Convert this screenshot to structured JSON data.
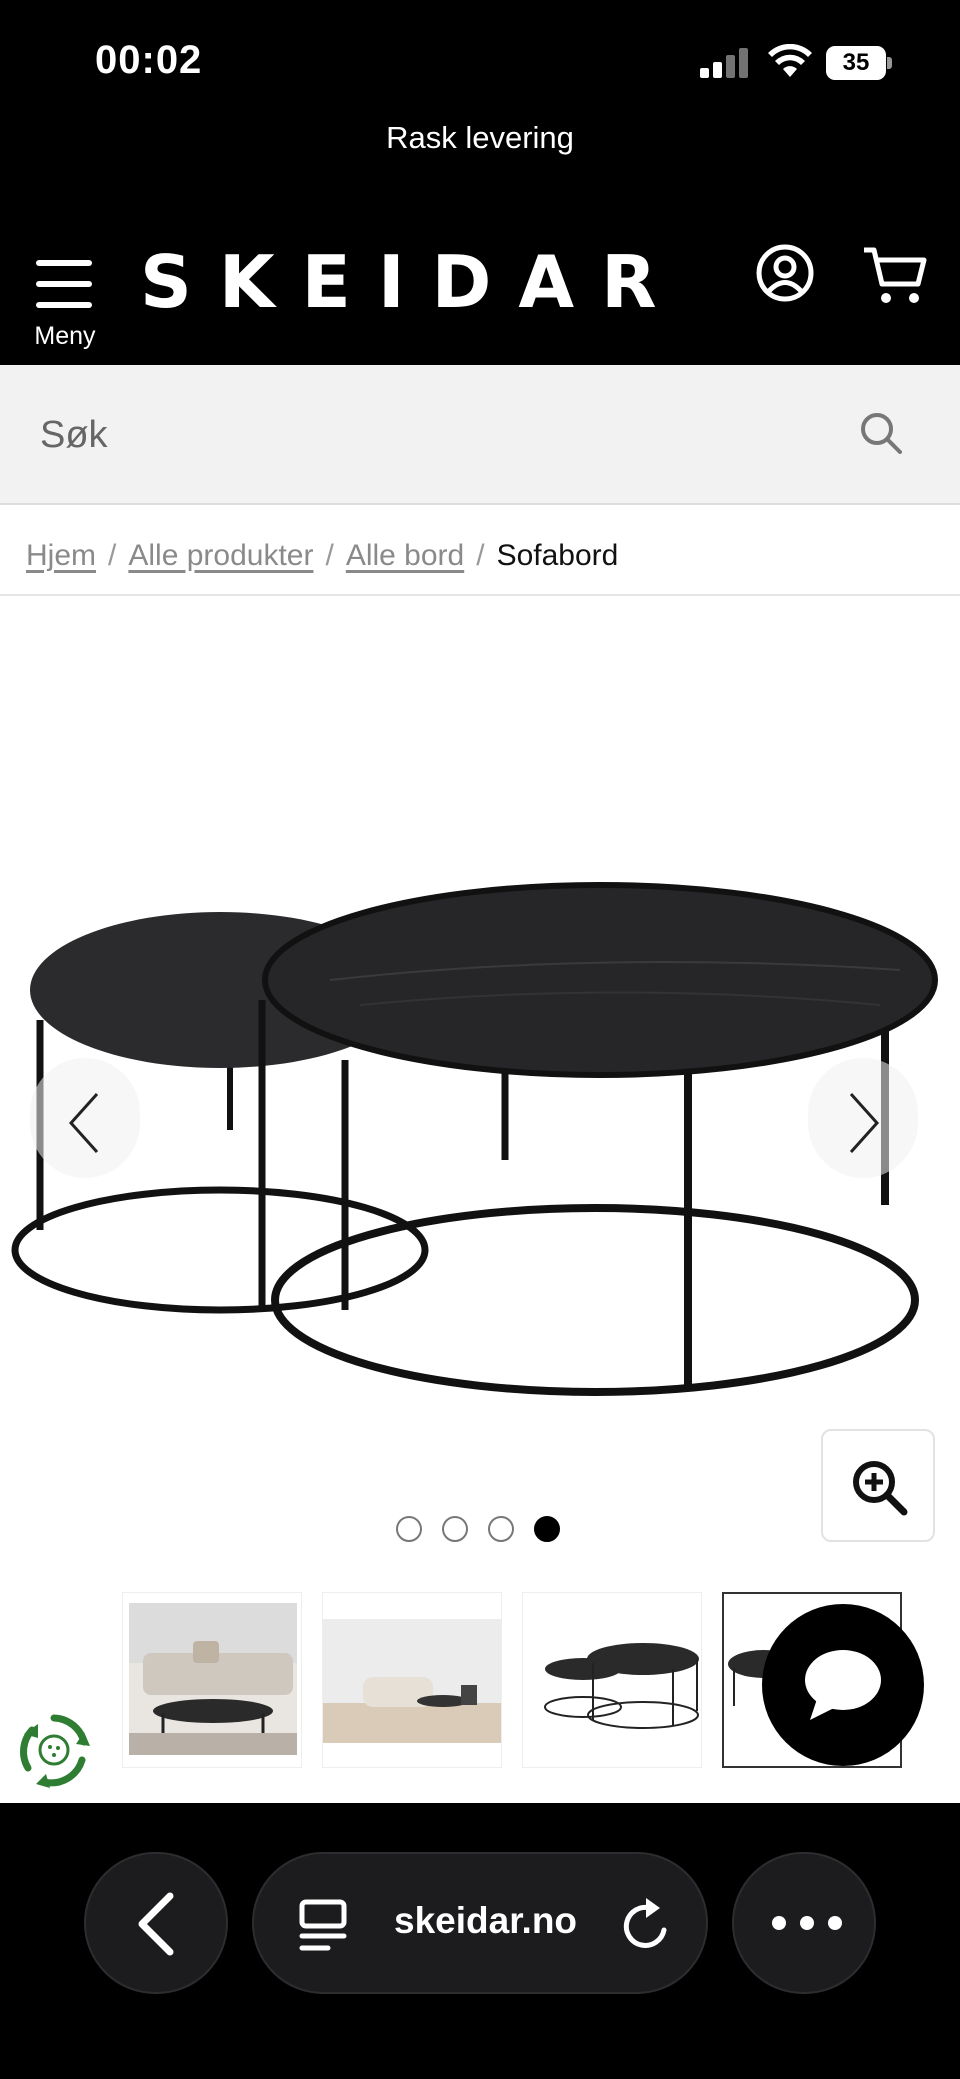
{
  "status_bar": {
    "time": "00:02",
    "battery": "35"
  },
  "promo": {
    "text": "Rask levering"
  },
  "header": {
    "logo": "SKEIDAR",
    "menu_label": "Meny"
  },
  "search": {
    "placeholder": "Søk",
    "value": ""
  },
  "breadcrumb": [
    {
      "label": "Hjem",
      "link": true
    },
    {
      "label": "Alle produkter",
      "link": true
    },
    {
      "label": "Alle bord",
      "link": true
    },
    {
      "label": "Sofabord",
      "link": false
    }
  ],
  "gallery": {
    "total_images": 4,
    "active_index": 4
  },
  "browser": {
    "url": "skeidar.no"
  },
  "icons": {
    "menu": "hamburger-icon",
    "account": "user-circle-icon",
    "cart": "cart-icon",
    "search": "search-icon",
    "prev": "chevron-left-icon",
    "next": "chevron-right-icon",
    "zoom": "zoom-in-icon",
    "chat": "chat-bubble-icon",
    "eco": "recycle-leaf-icon",
    "back": "back-chevron-icon",
    "tabs": "tabs-icon",
    "reload": "reload-icon",
    "more": "more-dots-icon"
  },
  "colors": {
    "header_bg": "#000000",
    "search_bg": "#f2f2f2",
    "text": "#111111",
    "muted": "#8a8a8a",
    "eco_green": "#2e7d32"
  }
}
